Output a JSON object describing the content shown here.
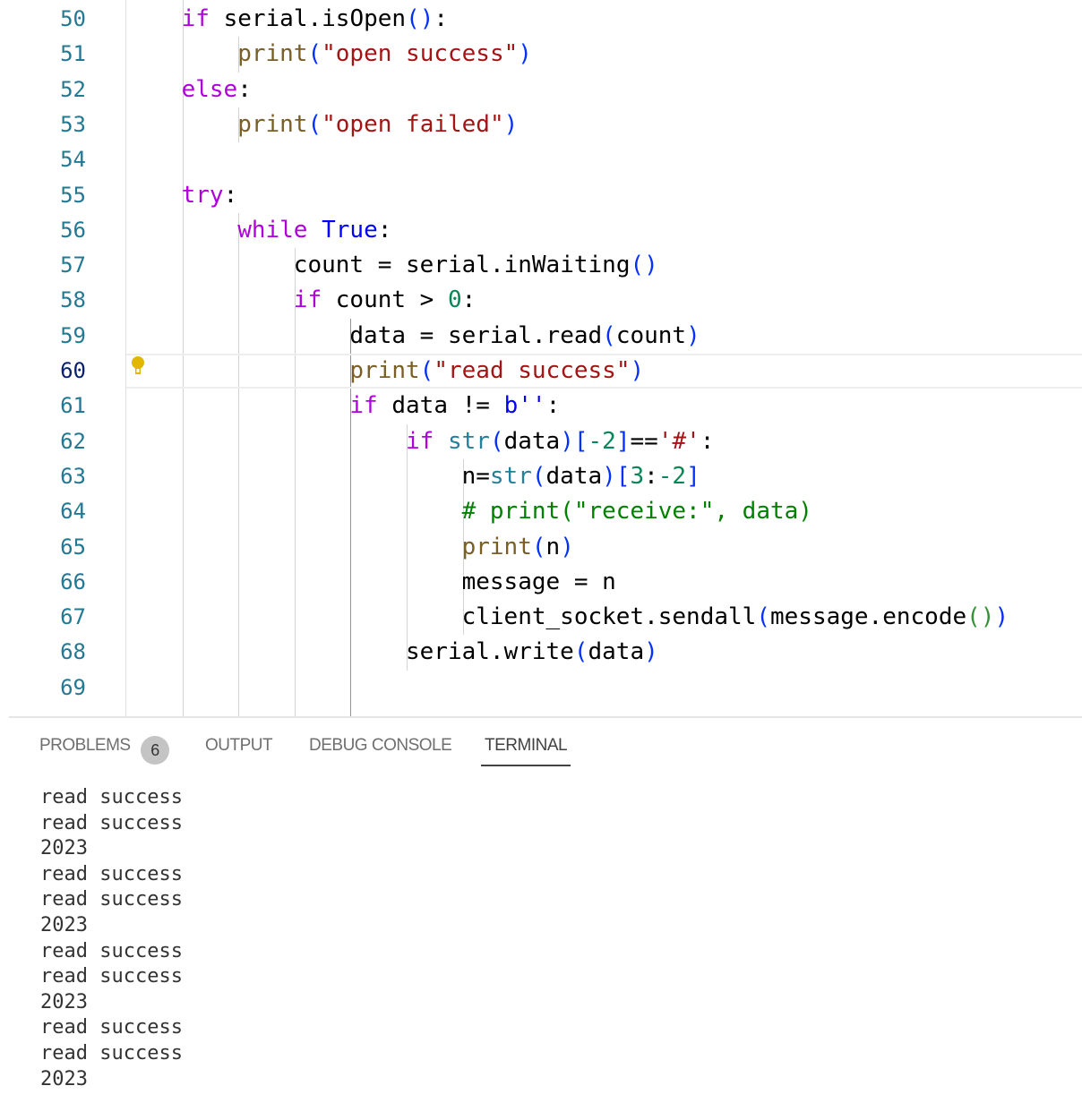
{
  "editor": {
    "active_line": 60,
    "lines": [
      {
        "n": "50",
        "indent": 1,
        "tokens": [
          [
            "if ",
            "kw"
          ],
          [
            "serial.isOpen",
            "tx"
          ],
          [
            "(",
            "b1"
          ],
          [
            ")",
            "b1"
          ],
          [
            ":",
            "tx"
          ]
        ]
      },
      {
        "n": "51",
        "indent": 2,
        "tokens": [
          [
            "print",
            "fn"
          ],
          [
            "(",
            "b1"
          ],
          [
            "\"open success\"",
            "str"
          ],
          [
            ")",
            "b1"
          ]
        ]
      },
      {
        "n": "52",
        "indent": 1,
        "tokens": [
          [
            "else",
            "kw"
          ],
          [
            ":",
            "tx"
          ]
        ]
      },
      {
        "n": "53",
        "indent": 2,
        "tokens": [
          [
            "print",
            "fn"
          ],
          [
            "(",
            "b1"
          ],
          [
            "\"open failed\"",
            "str"
          ],
          [
            ")",
            "b1"
          ]
        ]
      },
      {
        "n": "54",
        "indent": 0,
        "tokens": []
      },
      {
        "n": "55",
        "indent": 1,
        "tokens": [
          [
            "try",
            "kw"
          ],
          [
            ":",
            "tx"
          ]
        ]
      },
      {
        "n": "56",
        "indent": 2,
        "tokens": [
          [
            "while ",
            "kw"
          ],
          [
            "True",
            "ctl"
          ],
          [
            ":",
            "tx"
          ]
        ]
      },
      {
        "n": "57",
        "indent": 3,
        "tokens": [
          [
            "count = serial.inWaiting",
            "tx"
          ],
          [
            "(",
            "b1"
          ],
          [
            ")",
            "b1"
          ]
        ]
      },
      {
        "n": "58",
        "indent": 3,
        "tokens": [
          [
            "if ",
            "kw"
          ],
          [
            "count > ",
            "tx"
          ],
          [
            "0",
            "num"
          ],
          [
            ":",
            "tx"
          ]
        ]
      },
      {
        "n": "59",
        "indent": 4,
        "tokens": [
          [
            "data = serial.read",
            "tx"
          ],
          [
            "(",
            "b1"
          ],
          [
            "count",
            "tx"
          ],
          [
            ")",
            "b1"
          ]
        ]
      },
      {
        "n": "60",
        "indent": 4,
        "tokens": [
          [
            "print",
            "fn"
          ],
          [
            "(",
            "b1"
          ],
          [
            "\"read success\"",
            "str"
          ],
          [
            ")",
            "b1"
          ]
        ]
      },
      {
        "n": "61",
        "indent": 4,
        "tokens": [
          [
            "if ",
            "kw"
          ],
          [
            "data != ",
            "tx"
          ],
          [
            "b''",
            "ctl"
          ],
          [
            ":",
            "tx"
          ]
        ]
      },
      {
        "n": "62",
        "indent": 5,
        "tokens": [
          [
            "if ",
            "kw"
          ],
          [
            "str",
            "cls"
          ],
          [
            "(",
            "b1"
          ],
          [
            "data",
            "tx"
          ],
          [
            ")",
            "b1"
          ],
          [
            "[",
            "b1"
          ],
          [
            "-2",
            "num"
          ],
          [
            "]",
            "b1"
          ],
          [
            "==",
            "tx"
          ],
          [
            "'#'",
            "str"
          ],
          [
            ":",
            "tx"
          ]
        ]
      },
      {
        "n": "63",
        "indent": 6,
        "tokens": [
          [
            "n=",
            "tx"
          ],
          [
            "str",
            "cls"
          ],
          [
            "(",
            "b1"
          ],
          [
            "data",
            "tx"
          ],
          [
            ")",
            "b1"
          ],
          [
            "[",
            "b1"
          ],
          [
            "3",
            "num"
          ],
          [
            ":",
            "tx"
          ],
          [
            "-2",
            "num"
          ],
          [
            "]",
            "b1"
          ]
        ]
      },
      {
        "n": "64",
        "indent": 6,
        "tokens": [
          [
            "# print(\"receive:\", data)",
            "cm"
          ]
        ]
      },
      {
        "n": "65",
        "indent": 6,
        "tokens": [
          [
            "print",
            "fn"
          ],
          [
            "(",
            "b1"
          ],
          [
            "n",
            "tx"
          ],
          [
            ")",
            "b1"
          ]
        ]
      },
      {
        "n": "66",
        "indent": 6,
        "tokens": [
          [
            "message = n",
            "tx"
          ]
        ]
      },
      {
        "n": "67",
        "indent": 6,
        "tokens": [
          [
            "client_socket.sendall",
            "tx"
          ],
          [
            "(",
            "b1"
          ],
          [
            "message.encode",
            "tx"
          ],
          [
            "(",
            "b2"
          ],
          [
            ")",
            "b2"
          ],
          [
            ")",
            "b1"
          ]
        ]
      },
      {
        "n": "68",
        "indent": 5,
        "tokens": [
          [
            "serial.write",
            "tx"
          ],
          [
            "(",
            "b1"
          ],
          [
            "data",
            "tx"
          ],
          [
            ")",
            "b1"
          ]
        ]
      },
      {
        "n": "69",
        "indent": 0,
        "tokens": []
      }
    ],
    "lightbulb_icon_color": "#e2b700"
  },
  "panel": {
    "tabs": [
      {
        "label": "PROBLEMS",
        "badge": "6"
      },
      {
        "label": "OUTPUT"
      },
      {
        "label": "DEBUG CONSOLE"
      },
      {
        "label": "TERMINAL",
        "active": true
      }
    ],
    "terminal_lines": [
      "read success",
      "read success",
      "2023",
      "read success",
      "read success",
      "2023",
      "read success",
      "read success",
      "2023",
      "read success",
      "read success",
      "2023"
    ]
  }
}
